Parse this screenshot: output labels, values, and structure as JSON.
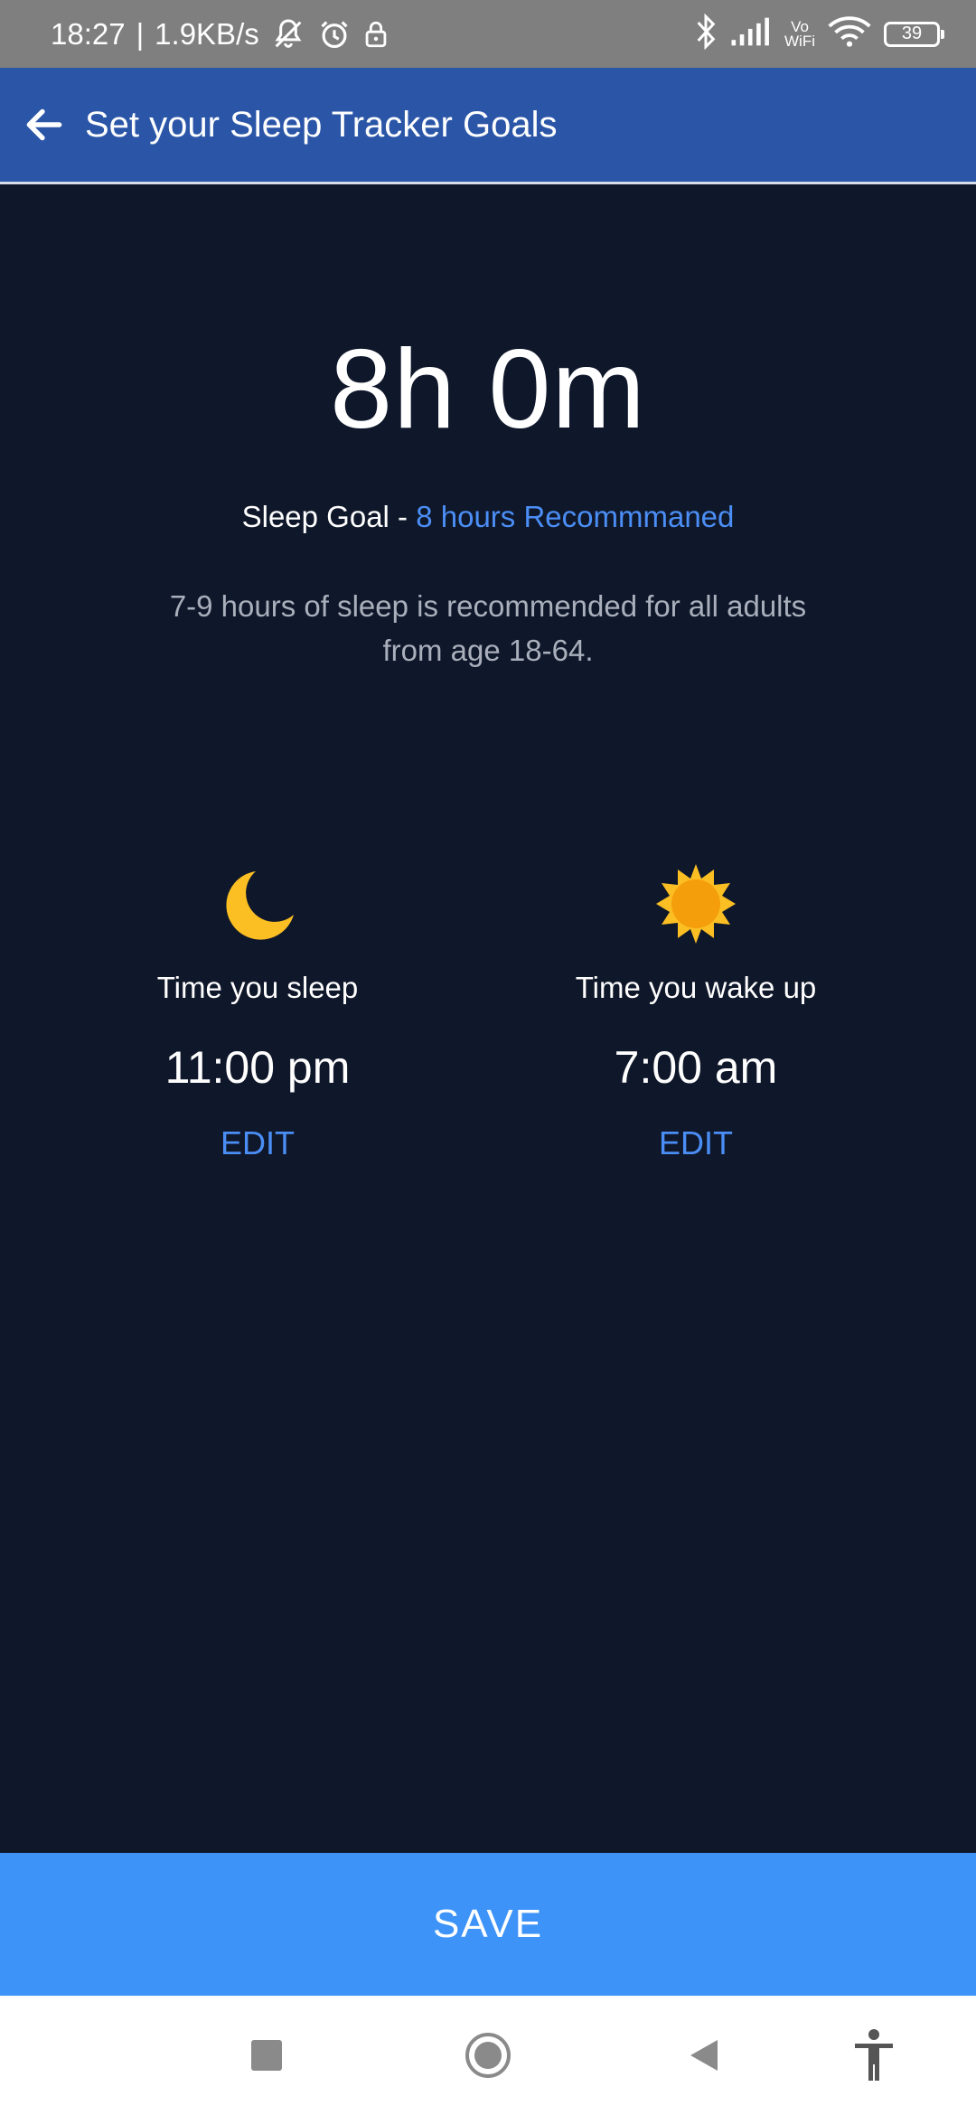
{
  "status_bar": {
    "time": "18:27",
    "separator": "|",
    "net_speed": "1.9KB/s",
    "vowifi_top": "Vo",
    "vowifi_bottom": "WiFi",
    "battery": "39"
  },
  "app_bar": {
    "title": "Set your Sleep Tracker Goals"
  },
  "summary": {
    "duration": "8h 0m",
    "goal_label": "Sleep Goal - ",
    "goal_recommendation": "8 hours Recommmaned",
    "recommendation_text": "7-9 hours of sleep is recommended for all adults from age 18-64."
  },
  "sleep": {
    "icon": "moon-icon",
    "label": "Time you sleep",
    "time": "11:00 pm",
    "edit_label": "EDIT"
  },
  "wake": {
    "icon": "sun-icon",
    "label": "Time you wake up",
    "time": "7:00 am",
    "edit_label": "EDIT"
  },
  "save_label": "SAVE",
  "colors": {
    "background": "#0f172a",
    "app_bar": "#2b56a8",
    "accent": "#4b8ef5",
    "save_button": "#3d93f8",
    "icon_yellow": "#fbbf24"
  }
}
